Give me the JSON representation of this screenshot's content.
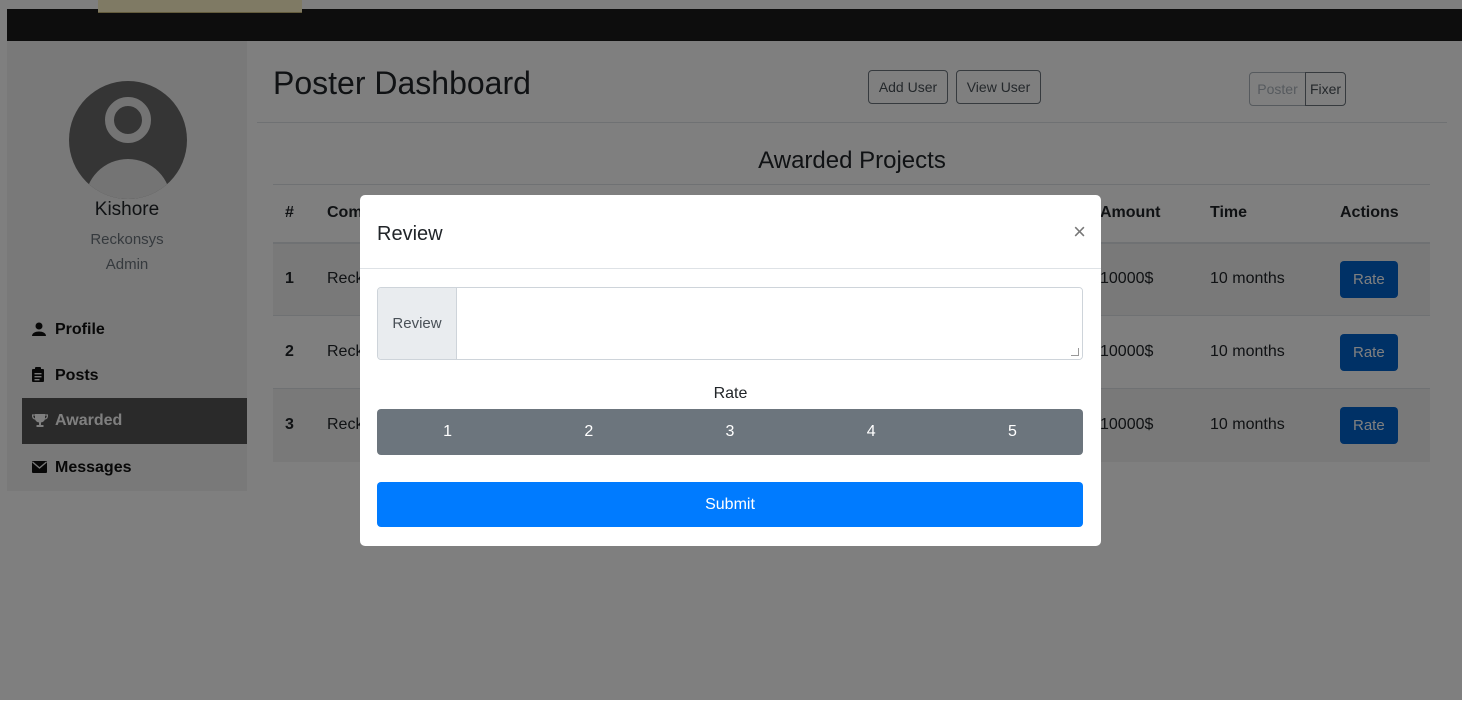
{
  "sidebar": {
    "name": "Kishore",
    "org": "Reckonsys",
    "role": "Admin",
    "items": [
      {
        "label": "Profile",
        "icon": "user-icon"
      },
      {
        "label": "Posts",
        "icon": "clipboard-icon"
      },
      {
        "label": "Awarded",
        "icon": "trophy-icon"
      },
      {
        "label": "Messages",
        "icon": "envelope-icon"
      }
    ]
  },
  "header": {
    "title": "Poster Dashboard",
    "add_user": "Add User",
    "view_user": "View User",
    "poster": "Poster",
    "fixer": "Fixer"
  },
  "section": {
    "title": "Awarded Projects"
  },
  "table": {
    "headers": [
      "#",
      "Com",
      "Amount",
      "Time",
      "Actions"
    ],
    "rows": [
      {
        "num": "1",
        "company": "Reck",
        "amount": "10000$",
        "time": "10 months",
        "action": "Rate"
      },
      {
        "num": "2",
        "company": "Reck",
        "amount": "10000$",
        "time": "10 months",
        "action": "Rate"
      },
      {
        "num": "3",
        "company": "Reck",
        "amount": "10000$",
        "time": "10 months",
        "action": "Rate"
      }
    ]
  },
  "modal": {
    "title": "Review",
    "close": "×",
    "review_label": "Review",
    "review_value": "",
    "rate_label": "Rate",
    "rate_options": [
      "1",
      "2",
      "3",
      "4",
      "5"
    ],
    "submit": "Submit"
  },
  "colors": {
    "primary": "#007bff",
    "secondary": "#6c757d",
    "topbar": "#1b1b1b",
    "active_nav": "#555555"
  }
}
